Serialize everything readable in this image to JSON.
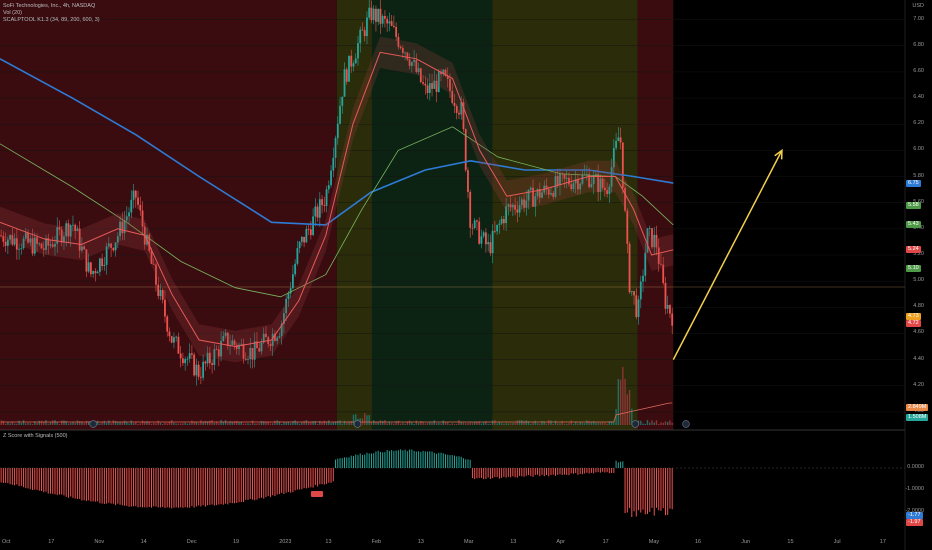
{
  "header": {
    "line1": "SoFi Technologies, Inc., 4h, NASDAQ",
    "line2": "Vol (20)",
    "line3": "SCALPTOOL K1.3 (34, 89, 200, 600, 3)",
    "zscore_title": "Z Score with Signals (500)",
    "currency": "USD"
  },
  "colors": {
    "background": "#000000",
    "zone_red": "#3a0c10",
    "zone_yellow": "#2b2d0a",
    "zone_green": "#0c2314",
    "candle_up": "#26a69a",
    "candle_down": "#ef5350",
    "ma_blue": "#2e7bd6",
    "ma_green": "#7bb661",
    "ma_red": "#e85a5a",
    "arrow": "#f2d04b"
  },
  "chart_data": {
    "type": "candlestick",
    "y_axis_ticks": [
      "7.00",
      "6.80",
      "6.60",
      "6.40",
      "6.20",
      "6.00",
      "5.80",
      "5.60",
      "5.40",
      "5.20",
      "5.00",
      "4.80",
      "4.60",
      "4.40",
      "4.20",
      "4.00"
    ],
    "ylim": [
      3.9,
      7.15
    ],
    "x_tick_labels": [
      "Oct",
      "17",
      "Nov",
      "14",
      "Dec",
      "19",
      "2023",
      "13",
      "Feb",
      "13",
      "Mar",
      "13",
      "Apr",
      "17",
      "May",
      "16",
      "Jun",
      "15",
      "Jul",
      "17"
    ],
    "price_tags": [
      {
        "label": "6.75",
        "price": 5.75,
        "color": "#2e7bd6"
      },
      {
        "label": "5.58",
        "price": 5.58,
        "color": "#4f9a48"
      },
      {
        "label": "5.43",
        "price": 5.43,
        "color": "#4f9a48"
      },
      {
        "label": "5.24",
        "price": 5.24,
        "color": "#e04848"
      },
      {
        "label": "5.10",
        "price": 5.1,
        "color": "#4f9a48"
      },
      {
        "label": "4.73",
        "price": 4.73,
        "color": "#f0a020"
      },
      {
        "label": "4.72",
        "price": 4.68,
        "color": "#e04848"
      }
    ],
    "volume_tags": [
      {
        "label": "2.849M",
        "color": "#e8894a"
      },
      {
        "label": "1.508M",
        "color": "#26a69a"
      }
    ],
    "zscore_ticks": [
      "0.0000",
      "-1.0000",
      "-2.0000"
    ],
    "zscore_tags": [
      {
        "label": "-1.77",
        "color": "#2e7bd6"
      },
      {
        "label": "-1.97",
        "color": "#e04848"
      }
    ],
    "zones": [
      {
        "color": "red",
        "start": 0.0,
        "end": 0.3722
      },
      {
        "color": "yellow",
        "start": 0.3722,
        "end": 0.411
      },
      {
        "color": "green",
        "start": 0.411,
        "end": 0.544
      },
      {
        "color": "yellow",
        "start": 0.544,
        "end": 0.7045
      },
      {
        "color": "red",
        "start": 0.7045,
        "end": 0.744
      }
    ],
    "key_prices": [
      {
        "t": 0.0,
        "p": 5.35
      },
      {
        "t": 0.05,
        "p": 5.25
      },
      {
        "t": 0.08,
        "p": 5.45
      },
      {
        "t": 0.1,
        "p": 5.05
      },
      {
        "t": 0.13,
        "p": 5.35
      },
      {
        "t": 0.15,
        "p": 5.65
      },
      {
        "t": 0.17,
        "p": 5.05
      },
      {
        "t": 0.19,
        "p": 4.55
      },
      {
        "t": 0.22,
        "p": 4.3
      },
      {
        "t": 0.25,
        "p": 4.55
      },
      {
        "t": 0.28,
        "p": 4.45
      },
      {
        "t": 0.31,
        "p": 4.65
      },
      {
        "t": 0.33,
        "p": 5.25
      },
      {
        "t": 0.36,
        "p": 5.65
      },
      {
        "t": 0.38,
        "p": 6.55
      },
      {
        "t": 0.41,
        "p": 7.05
      },
      {
        "t": 0.43,
        "p": 6.95
      },
      {
        "t": 0.45,
        "p": 6.75
      },
      {
        "t": 0.47,
        "p": 6.45
      },
      {
        "t": 0.49,
        "p": 6.55
      },
      {
        "t": 0.51,
        "p": 6.3
      },
      {
        "t": 0.52,
        "p": 5.45
      },
      {
        "t": 0.54,
        "p": 5.25
      },
      {
        "t": 0.56,
        "p": 5.55
      },
      {
        "t": 0.59,
        "p": 5.65
      },
      {
        "t": 0.62,
        "p": 5.75
      },
      {
        "t": 0.65,
        "p": 5.8
      },
      {
        "t": 0.67,
        "p": 5.7
      },
      {
        "t": 0.685,
        "p": 6.15
      },
      {
        "t": 0.695,
        "p": 5.0
      },
      {
        "t": 0.705,
        "p": 4.75
      },
      {
        "t": 0.715,
        "p": 5.35
      },
      {
        "t": 0.725,
        "p": 5.3
      },
      {
        "t": 0.735,
        "p": 4.85
      },
      {
        "t": 0.744,
        "p": 4.72
      }
    ],
    "ma_blue": [
      {
        "t": 0.0,
        "p": 6.7
      },
      {
        "t": 0.08,
        "p": 6.4
      },
      {
        "t": 0.15,
        "p": 6.12
      },
      {
        "t": 0.22,
        "p": 5.8
      },
      {
        "t": 0.3,
        "p": 5.45
      },
      {
        "t": 0.36,
        "p": 5.43
      },
      {
        "t": 0.41,
        "p": 5.68
      },
      {
        "t": 0.47,
        "p": 5.85
      },
      {
        "t": 0.52,
        "p": 5.92
      },
      {
        "t": 0.58,
        "p": 5.85
      },
      {
        "t": 0.65,
        "p": 5.85
      },
      {
        "t": 0.7,
        "p": 5.8
      },
      {
        "t": 0.744,
        "p": 5.75
      }
    ],
    "ma_green": [
      {
        "t": 0.0,
        "p": 6.05
      },
      {
        "t": 0.08,
        "p": 5.72
      },
      {
        "t": 0.14,
        "p": 5.45
      },
      {
        "t": 0.2,
        "p": 5.15
      },
      {
        "t": 0.26,
        "p": 4.95
      },
      {
        "t": 0.31,
        "p": 4.88
      },
      {
        "t": 0.36,
        "p": 5.05
      },
      {
        "t": 0.4,
        "p": 5.55
      },
      {
        "t": 0.44,
        "p": 6.0
      },
      {
        "t": 0.5,
        "p": 6.18
      },
      {
        "t": 0.55,
        "p": 5.95
      },
      {
        "t": 0.62,
        "p": 5.82
      },
      {
        "t": 0.68,
        "p": 5.8
      },
      {
        "t": 0.71,
        "p": 5.65
      },
      {
        "t": 0.744,
        "p": 5.43
      }
    ],
    "ma_red": [
      {
        "t": 0.0,
        "p": 5.45
      },
      {
        "t": 0.05,
        "p": 5.32
      },
      {
        "t": 0.09,
        "p": 5.28
      },
      {
        "t": 0.13,
        "p": 5.4
      },
      {
        "t": 0.16,
        "p": 5.35
      },
      {
        "t": 0.19,
        "p": 4.9
      },
      {
        "t": 0.22,
        "p": 4.55
      },
      {
        "t": 0.26,
        "p": 4.5
      },
      {
        "t": 0.3,
        "p": 4.55
      },
      {
        "t": 0.33,
        "p": 4.85
      },
      {
        "t": 0.36,
        "p": 5.35
      },
      {
        "t": 0.39,
        "p": 6.2
      },
      {
        "t": 0.42,
        "p": 6.75
      },
      {
        "t": 0.46,
        "p": 6.7
      },
      {
        "t": 0.5,
        "p": 6.55
      },
      {
        "t": 0.53,
        "p": 6.0
      },
      {
        "t": 0.56,
        "p": 5.65
      },
      {
        "t": 0.6,
        "p": 5.7
      },
      {
        "t": 0.65,
        "p": 5.8
      },
      {
        "t": 0.68,
        "p": 5.8
      },
      {
        "t": 0.7,
        "p": 5.55
      },
      {
        "t": 0.72,
        "p": 5.2
      },
      {
        "t": 0.744,
        "p": 5.24
      }
    ],
    "arrow": {
      "from": {
        "t": 0.744,
        "p": 4.4
      },
      "to": {
        "t": 0.864,
        "p": 6.0
      }
    }
  }
}
